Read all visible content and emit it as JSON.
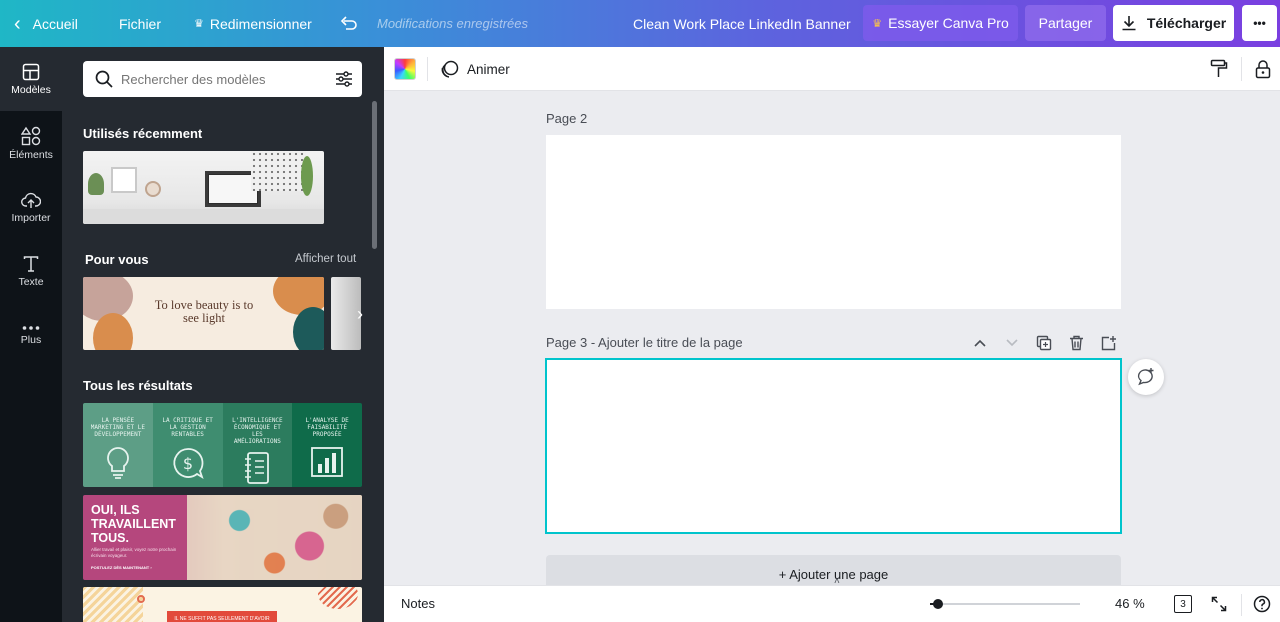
{
  "topbar": {
    "home_label": "Accueil",
    "file_label": "Fichier",
    "resize_label": "Redimensionner",
    "status_text": "Modifications enregistrées",
    "doc_title": "Clean Work Place LinkedIn Banner",
    "try_pro_label": "Essayer Canva Pro",
    "share_label": "Partager",
    "download_label": "Télécharger",
    "more_label": "•••"
  },
  "rail": {
    "items": [
      {
        "label": "Modèles",
        "icon": "templates-icon"
      },
      {
        "label": "Éléments",
        "icon": "elements-icon"
      },
      {
        "label": "Importer",
        "icon": "upload-icon"
      },
      {
        "label": "Texte",
        "icon": "text-icon"
      },
      {
        "label": "Plus",
        "icon": "more-icon"
      }
    ]
  },
  "panel": {
    "search_placeholder": "Rechercher des modèles",
    "recent_title": "Utilisés récemment",
    "for_you_title": "Pour vous",
    "see_all_label": "Afficher tout",
    "for_you_card_text": "To love beauty is to see light",
    "all_results_title": "Tous les résultats",
    "result_columns": [
      "LA PENSÉE MARKETING ET LE DÉVELOPPEMENT",
      "LA CRITIQUE ET LA GESTION RENTABLES",
      "L'INTELLIGENCE ÉCONOMIQUE ET LES AMÉLIORATIONS",
      "L'ANALYSE DE FAISABILITÉ PROPOSÉE"
    ],
    "beach_card": {
      "headline": "OUI, ILS TRAVAILLENT TOUS.",
      "body": "Allier travail et plaisir, voyez notre prochain écrivain voyageur.",
      "cta": "POSTULEZ DÈS MAINTENANT ›"
    },
    "third_card_text": "IL NE SUFFIT PAS SEULEMENT D'AVOIR"
  },
  "toolbar": {
    "animate_label": "Animer"
  },
  "canvas": {
    "page2_label": "Page 2",
    "page3_label": "Page 3 - Ajouter le titre de la page",
    "add_page_label": "+ Ajouter une page"
  },
  "bottombar": {
    "notes_label": "Notes",
    "zoom_value": "46 %",
    "page_count": "3",
    "zoom_level": 0.05
  },
  "colors": {
    "accent": "#00c4cc",
    "rail_bg": "#0e1318",
    "panel_bg": "#252a31",
    "pro_button": "#7b4fe0"
  }
}
